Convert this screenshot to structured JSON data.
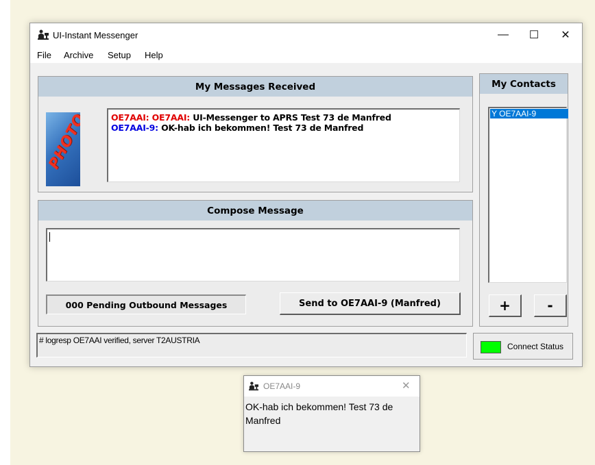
{
  "window": {
    "title": "UI-Instant Messenger",
    "minimize": "—",
    "maximize": "☐",
    "close": "✕"
  },
  "menu": [
    "File",
    "Archive",
    "Setup",
    "Help"
  ],
  "received": {
    "header": "My Messages Received",
    "photo_label": "PHOTO",
    "messages": [
      {
        "prefix": "OE7AAI: OE7AAI:",
        "text": " UI-Messenger to APRS Test 73 de Manfred",
        "color": "#e00000"
      },
      {
        "prefix": "OE7AAI-9:",
        "text": " OK-hab ich bekommen! Test 73 de Manfred",
        "color": "#0000e0"
      }
    ]
  },
  "compose": {
    "header": "Compose Message",
    "value": "",
    "pending": "000 Pending Outbound Messages",
    "send_label": "Send to OE7AAI-9 (Manfred)"
  },
  "contacts": {
    "header": "My Contacts",
    "items": [
      "Y OE7AAI-9"
    ],
    "add_label": "+",
    "remove_label": "-"
  },
  "status": {
    "log": "# logresp OE7AAI verified, server T2AUSTRIA",
    "connect_label": "Connect Status",
    "connect_color": "#00ff00"
  },
  "popup": {
    "title": "OE7AAI-9",
    "close": "✕",
    "message": "OK-hab ich bekommen! Test 73 de Manfred"
  }
}
